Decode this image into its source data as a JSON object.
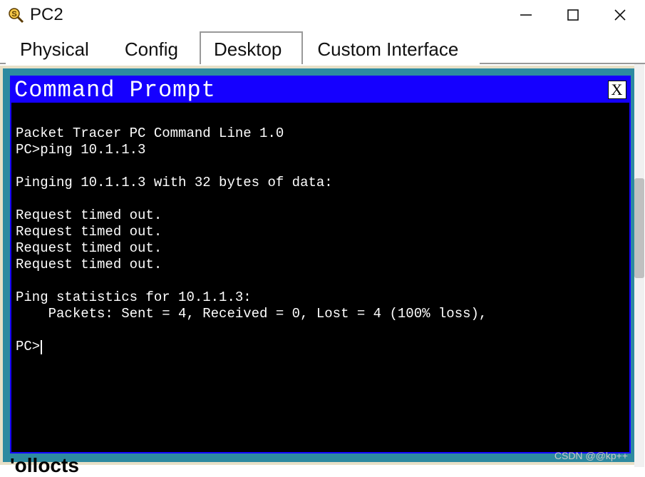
{
  "window": {
    "title": "PC2",
    "controls": {
      "min": "—",
      "max": "▢",
      "close": "✕"
    }
  },
  "tabs": [
    {
      "label": "Physical",
      "active": false
    },
    {
      "label": "Config",
      "active": false
    },
    {
      "label": "Desktop",
      "active": true
    },
    {
      "label": "Custom Interface",
      "active": false
    }
  ],
  "cmd": {
    "title": "Command Prompt",
    "close": "X",
    "lines": {
      "l0": "Packet Tracer PC Command Line 1.0",
      "l1": "PC>ping 10.1.1.3",
      "l2": "",
      "l3": "Pinging 10.1.1.3 with 32 bytes of data:",
      "l4": "",
      "l5": "Request timed out.",
      "l6": "Request timed out.",
      "l7": "Request timed out.",
      "l8": "Request timed out.",
      "l9": "",
      "l10": "Ping statistics for 10.1.1.3:",
      "l11": "    Packets: Sent = 4, Received = 0, Lost = 4 (100% loss),",
      "l12": "",
      "l13": "PC>"
    }
  },
  "watermark": "CSDN @@kp++",
  "footer_fragment": "'ollocts"
}
